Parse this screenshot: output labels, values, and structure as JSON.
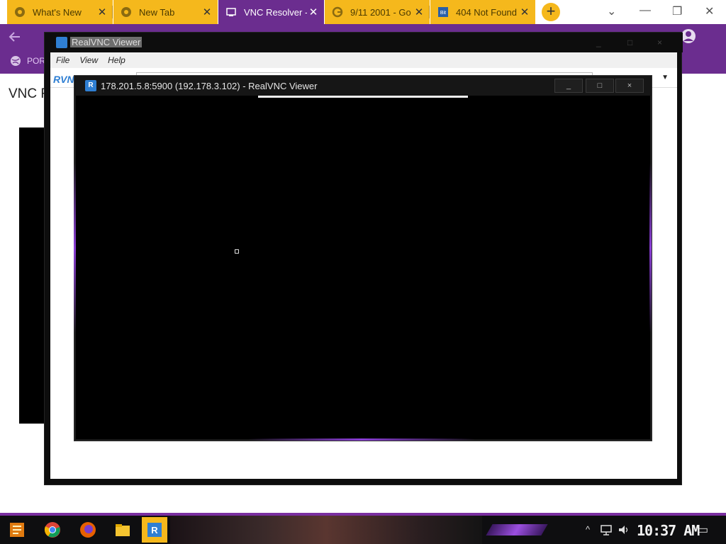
{
  "browser": {
    "tabs": [
      {
        "title": "What's New",
        "icon": "chrome-icon",
        "active": false
      },
      {
        "title": "New Tab",
        "icon": "chrome-icon",
        "active": false
      },
      {
        "title": "VNC Resolver -",
        "icon": "vnc-resolver-icon",
        "active": true
      },
      {
        "title": "9/11 2001 - Go",
        "icon": "google-icon",
        "active": false
      },
      {
        "title": "404 Not Found",
        "icon": "bitview-icon",
        "active": false
      }
    ],
    "close_glyph": "✕",
    "new_tab_glyph": "+",
    "window_controls": {
      "tabsearch": "⌄",
      "minimize": "—",
      "restore": "❐",
      "close": "✕"
    },
    "bookmark_label": "POR",
    "page_heading": "VNC Re"
  },
  "outer_window": {
    "title": "RealVNC Viewer",
    "menu": [
      "File",
      "View",
      "Help"
    ],
    "toolbar_logo": "RVNC",
    "dropdown_glyph": "▼"
  },
  "inner_window": {
    "title": "178.201.5.8:5900 (192.178.3.102) - RealVNC Viewer",
    "logo_text": "R",
    "controls": {
      "minimize": "_",
      "maximize": "□",
      "close": "×"
    }
  },
  "taskbar": {
    "clock": "10:37 AM",
    "apps": [
      "start-icon",
      "chrome-icon",
      "firefox-icon",
      "file-explorer-icon",
      "realvnc-icon"
    ],
    "tray_chevron": "^",
    "notification_glyph": "▭"
  },
  "colors": {
    "tab_yellow": "#f5b81c",
    "tab_active_purple": "#6b2d8f",
    "vnc_blue": "#2f7fd3"
  }
}
